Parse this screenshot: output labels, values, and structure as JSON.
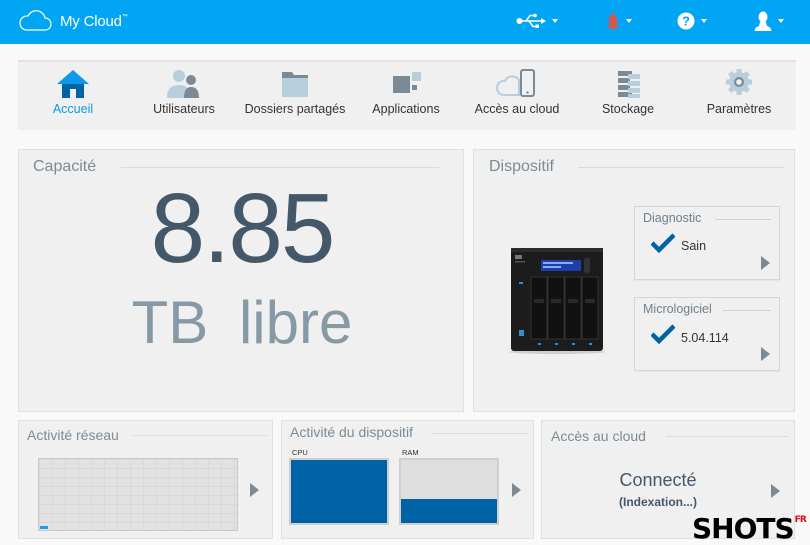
{
  "header": {
    "app_name": "My Cloud",
    "trademark": "™",
    "icons": [
      {
        "name": "usb-icon",
        "has_dropdown": true
      },
      {
        "name": "alert-bell-icon",
        "has_dropdown": true,
        "color": "#d9534f"
      },
      {
        "name": "help-icon",
        "has_dropdown": true
      },
      {
        "name": "user-icon",
        "has_dropdown": true
      }
    ],
    "brand_color": "#00a6f4"
  },
  "nav": {
    "items": [
      {
        "label": "Accueil",
        "icon": "home-icon",
        "active": true
      },
      {
        "label": "Utilisateurs",
        "icon": "users-icon",
        "active": false
      },
      {
        "label": "Dossiers partagés",
        "icon": "folder-icon",
        "active": false
      },
      {
        "label": "Applications",
        "icon": "apps-icon",
        "active": false
      },
      {
        "label": "Accès au cloud",
        "icon": "cloud-device-icon",
        "active": false
      },
      {
        "label": "Stockage",
        "icon": "storage-icon",
        "active": false
      },
      {
        "label": "Paramètres",
        "icon": "gear-icon",
        "active": false
      }
    ],
    "active_color": "#0a9ae9"
  },
  "capacity": {
    "title": "Capacité",
    "value": "8.85",
    "unit": "TB libre"
  },
  "device": {
    "title": "Dispositif",
    "diagnostic": {
      "title": "Diagnostic",
      "value": "Sain",
      "status": "ok"
    },
    "firmware": {
      "title": "Micrologiciel",
      "value": "5.04.114",
      "status": "ok"
    }
  },
  "network_activity": {
    "title": "Activité réseau",
    "level_percent": 4
  },
  "device_activity": {
    "title": "Activité du dispositif",
    "cpu": {
      "label": "CPU",
      "percent": 100
    },
    "ram": {
      "label": "RAM",
      "percent": 38
    }
  },
  "cloud_access": {
    "title": "Accès au cloud",
    "status": "Connecté",
    "substatus": "(Indexation...)"
  },
  "watermark": {
    "text": "SHOTS",
    "suffix": "FR"
  }
}
